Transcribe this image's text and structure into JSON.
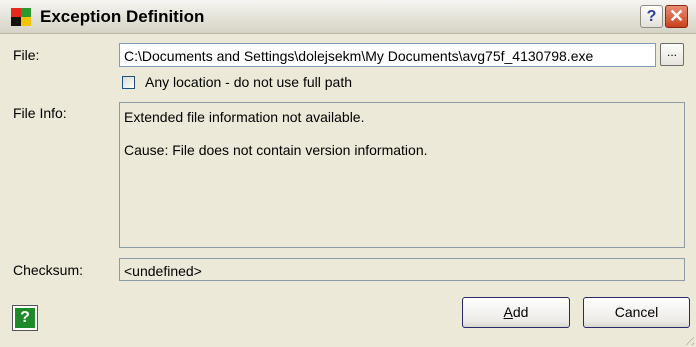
{
  "window": {
    "title": "Exception Definition",
    "help_glyph": "?",
    "close_glyph": "✕",
    "logo_colors": [
      "#e8281c",
      "#2b9a2e",
      "#f5c400",
      "#111111"
    ]
  },
  "form": {
    "file_label": "File:",
    "file_value": "C:\\Documents and Settings\\dolejsekm\\My Documents\\avg75f_4130798.exe",
    "browse_label": "...",
    "any_location_label": "Any location - do not use full path",
    "any_location_checked": false,
    "file_info_label": "File Info:",
    "file_info_lines": [
      "Extended file information not available.",
      "Cause: File does not contain version information."
    ],
    "checksum_label": "Checksum:",
    "checksum_value": "<undefined>"
  },
  "buttons": {
    "help_glyph": "?",
    "add_accel": "A",
    "add_rest": "dd",
    "cancel": "Cancel"
  }
}
